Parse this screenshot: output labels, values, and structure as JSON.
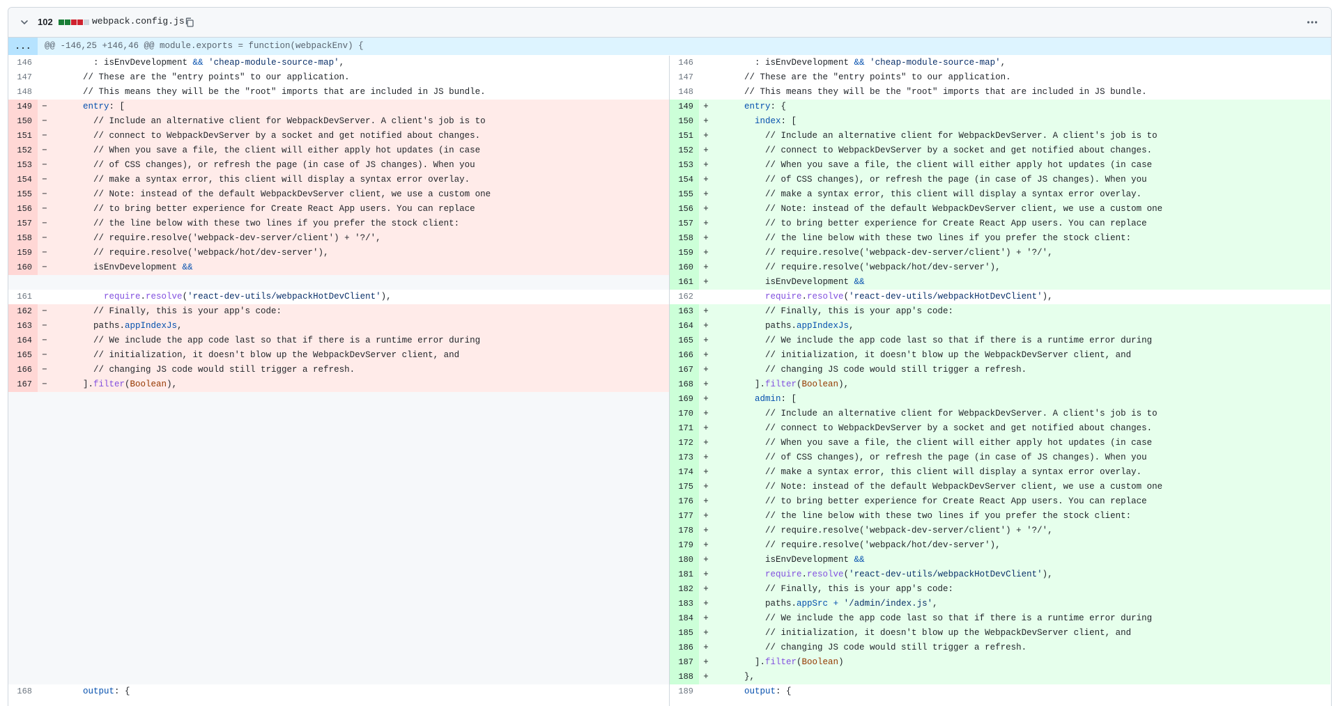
{
  "file": {
    "change_count": "102",
    "name": "webpack.config.js",
    "diffstat_colors": [
      "#1a7f37",
      "#1a7f37",
      "#cf222e",
      "#cf222e",
      "#d0d7de"
    ]
  },
  "hunk": {
    "expander_label": "...",
    "header": "@@ -146,25 +146,46 @@ module.exports = function(webpackEnv) {"
  },
  "left": [
    {
      "type": "ctx",
      "num": "146",
      "marker": "",
      "code": "        : isEnvDevelopment && 'cheap-module-source-map',"
    },
    {
      "type": "ctx",
      "num": "147",
      "marker": "",
      "code": "      // These are the \"entry points\" to our application."
    },
    {
      "type": "ctx",
      "num": "148",
      "marker": "",
      "code": "      // This means they will be the \"root\" imports that are included in JS bundle."
    },
    {
      "type": "del",
      "num": "149",
      "marker": "−",
      "code": "      entry: ["
    },
    {
      "type": "del",
      "num": "150",
      "marker": "−",
      "code": "        // Include an alternative client for WebpackDevServer. A client's job is to"
    },
    {
      "type": "del",
      "num": "151",
      "marker": "−",
      "code": "        // connect to WebpackDevServer by a socket and get notified about changes."
    },
    {
      "type": "del",
      "num": "152",
      "marker": "−",
      "code": "        // When you save a file, the client will either apply hot updates (in case"
    },
    {
      "type": "del",
      "num": "153",
      "marker": "−",
      "code": "        // of CSS changes), or refresh the page (in case of JS changes). When you"
    },
    {
      "type": "del",
      "num": "154",
      "marker": "−",
      "code": "        // make a syntax error, this client will display a syntax error overlay."
    },
    {
      "type": "del",
      "num": "155",
      "marker": "−",
      "code": "        // Note: instead of the default WebpackDevServer client, we use a custom one"
    },
    {
      "type": "del",
      "num": "156",
      "marker": "−",
      "code": "        // to bring better experience for Create React App users. You can replace"
    },
    {
      "type": "del",
      "num": "157",
      "marker": "−",
      "code": "        // the line below with these two lines if you prefer the stock client:"
    },
    {
      "type": "del",
      "num": "158",
      "marker": "−",
      "code": "        // require.resolve('webpack-dev-server/client') + '?/',"
    },
    {
      "type": "del",
      "num": "159",
      "marker": "−",
      "code": "        // require.resolve('webpack/hot/dev-server'),"
    },
    {
      "type": "del",
      "num": "160",
      "marker": "−",
      "code": "        isEnvDevelopment &&"
    },
    {
      "type": "empty",
      "num": "",
      "marker": "",
      "code": ""
    },
    {
      "type": "ctx",
      "num": "161",
      "marker": "",
      "code": "          require.resolve('react-dev-utils/webpackHotDevClient'),"
    },
    {
      "type": "del",
      "num": "162",
      "marker": "−",
      "code": "        // Finally, this is your app's code:"
    },
    {
      "type": "del",
      "num": "163",
      "marker": "−",
      "code": "        paths.appIndexJs,"
    },
    {
      "type": "del",
      "num": "164",
      "marker": "−",
      "code": "        // We include the app code last so that if there is a runtime error during"
    },
    {
      "type": "del",
      "num": "165",
      "marker": "−",
      "code": "        // initialization, it doesn't blow up the WebpackDevServer client, and"
    },
    {
      "type": "del",
      "num": "166",
      "marker": "−",
      "code": "        // changing JS code would still trigger a refresh."
    },
    {
      "type": "del",
      "num": "167",
      "marker": "−",
      "code": "      ].filter(Boolean),"
    },
    {
      "type": "empty",
      "num": "",
      "marker": "",
      "code": ""
    },
    {
      "type": "empty",
      "num": "",
      "marker": "",
      "code": ""
    },
    {
      "type": "empty",
      "num": "",
      "marker": "",
      "code": ""
    },
    {
      "type": "empty",
      "num": "",
      "marker": "",
      "code": ""
    },
    {
      "type": "empty",
      "num": "",
      "marker": "",
      "code": ""
    },
    {
      "type": "empty",
      "num": "",
      "marker": "",
      "code": ""
    },
    {
      "type": "empty",
      "num": "",
      "marker": "",
      "code": ""
    },
    {
      "type": "empty",
      "num": "",
      "marker": "",
      "code": ""
    },
    {
      "type": "empty",
      "num": "",
      "marker": "",
      "code": ""
    },
    {
      "type": "empty",
      "num": "",
      "marker": "",
      "code": ""
    },
    {
      "type": "empty",
      "num": "",
      "marker": "",
      "code": ""
    },
    {
      "type": "empty",
      "num": "",
      "marker": "",
      "code": ""
    },
    {
      "type": "empty",
      "num": "",
      "marker": "",
      "code": ""
    },
    {
      "type": "empty",
      "num": "",
      "marker": "",
      "code": ""
    },
    {
      "type": "empty",
      "num": "",
      "marker": "",
      "code": ""
    },
    {
      "type": "empty",
      "num": "",
      "marker": "",
      "code": ""
    },
    {
      "type": "empty",
      "num": "",
      "marker": "",
      "code": ""
    },
    {
      "type": "empty",
      "num": "",
      "marker": "",
      "code": ""
    },
    {
      "type": "empty",
      "num": "",
      "marker": "",
      "code": ""
    },
    {
      "type": "empty",
      "num": "",
      "marker": "",
      "code": ""
    },
    {
      "type": "ctx",
      "num": "168",
      "marker": "",
      "code": "      output: {"
    }
  ],
  "right": [
    {
      "type": "ctx",
      "num": "146",
      "marker": "",
      "code": "        : isEnvDevelopment && 'cheap-module-source-map',"
    },
    {
      "type": "ctx",
      "num": "147",
      "marker": "",
      "code": "      // These are the \"entry points\" to our application."
    },
    {
      "type": "ctx",
      "num": "148",
      "marker": "",
      "code": "      // This means they will be the \"root\" imports that are included in JS bundle."
    },
    {
      "type": "add",
      "num": "149",
      "marker": "+",
      "code": "      entry: {"
    },
    {
      "type": "add",
      "num": "150",
      "marker": "+",
      "code": "        index: ["
    },
    {
      "type": "add",
      "num": "151",
      "marker": "+",
      "code": "          // Include an alternative client for WebpackDevServer. A client's job is to"
    },
    {
      "type": "add",
      "num": "152",
      "marker": "+",
      "code": "          // connect to WebpackDevServer by a socket and get notified about changes."
    },
    {
      "type": "add",
      "num": "153",
      "marker": "+",
      "code": "          // When you save a file, the client will either apply hot updates (in case"
    },
    {
      "type": "add",
      "num": "154",
      "marker": "+",
      "code": "          // of CSS changes), or refresh the page (in case of JS changes). When you"
    },
    {
      "type": "add",
      "num": "155",
      "marker": "+",
      "code": "          // make a syntax error, this client will display a syntax error overlay."
    },
    {
      "type": "add",
      "num": "156",
      "marker": "+",
      "code": "          // Note: instead of the default WebpackDevServer client, we use a custom one"
    },
    {
      "type": "add",
      "num": "157",
      "marker": "+",
      "code": "          // to bring better experience for Create React App users. You can replace"
    },
    {
      "type": "add",
      "num": "158",
      "marker": "+",
      "code": "          // the line below with these two lines if you prefer the stock client:"
    },
    {
      "type": "add",
      "num": "159",
      "marker": "+",
      "code": "          // require.resolve('webpack-dev-server/client') + '?/',"
    },
    {
      "type": "add",
      "num": "160",
      "marker": "+",
      "code": "          // require.resolve('webpack/hot/dev-server'),"
    },
    {
      "type": "add",
      "num": "161",
      "marker": "+",
      "code": "          isEnvDevelopment &&"
    },
    {
      "type": "ctx",
      "num": "162",
      "marker": "",
      "code": "          require.resolve('react-dev-utils/webpackHotDevClient'),"
    },
    {
      "type": "add",
      "num": "163",
      "marker": "+",
      "code": "          // Finally, this is your app's code:"
    },
    {
      "type": "add",
      "num": "164",
      "marker": "+",
      "code": "          paths.appIndexJs,"
    },
    {
      "type": "add",
      "num": "165",
      "marker": "+",
      "code": "          // We include the app code last so that if there is a runtime error during"
    },
    {
      "type": "add",
      "num": "166",
      "marker": "+",
      "code": "          // initialization, it doesn't blow up the WebpackDevServer client, and"
    },
    {
      "type": "add",
      "num": "167",
      "marker": "+",
      "code": "          // changing JS code would still trigger a refresh."
    },
    {
      "type": "add",
      "num": "168",
      "marker": "+",
      "code": "        ].filter(Boolean),"
    },
    {
      "type": "add",
      "num": "169",
      "marker": "+",
      "code": "        admin: ["
    },
    {
      "type": "add",
      "num": "170",
      "marker": "+",
      "code": "          // Include an alternative client for WebpackDevServer. A client's job is to"
    },
    {
      "type": "add",
      "num": "171",
      "marker": "+",
      "code": "          // connect to WebpackDevServer by a socket and get notified about changes."
    },
    {
      "type": "add",
      "num": "172",
      "marker": "+",
      "code": "          // When you save a file, the client will either apply hot updates (in case"
    },
    {
      "type": "add",
      "num": "173",
      "marker": "+",
      "code": "          // of CSS changes), or refresh the page (in case of JS changes). When you"
    },
    {
      "type": "add",
      "num": "174",
      "marker": "+",
      "code": "          // make a syntax error, this client will display a syntax error overlay."
    },
    {
      "type": "add",
      "num": "175",
      "marker": "+",
      "code": "          // Note: instead of the default WebpackDevServer client, we use a custom one"
    },
    {
      "type": "add",
      "num": "176",
      "marker": "+",
      "code": "          // to bring better experience for Create React App users. You can replace"
    },
    {
      "type": "add",
      "num": "177",
      "marker": "+",
      "code": "          // the line below with these two lines if you prefer the stock client:"
    },
    {
      "type": "add",
      "num": "178",
      "marker": "+",
      "code": "          // require.resolve('webpack-dev-server/client') + '?/',"
    },
    {
      "type": "add",
      "num": "179",
      "marker": "+",
      "code": "          // require.resolve('webpack/hot/dev-server'),"
    },
    {
      "type": "add",
      "num": "180",
      "marker": "+",
      "code": "          isEnvDevelopment &&"
    },
    {
      "type": "add",
      "num": "181",
      "marker": "+",
      "code": "          require.resolve('react-dev-utils/webpackHotDevClient'),"
    },
    {
      "type": "add",
      "num": "182",
      "marker": "+",
      "code": "          // Finally, this is your app's code:"
    },
    {
      "type": "add",
      "num": "183",
      "marker": "+",
      "code": "          paths.appSrc + '/admin/index.js',"
    },
    {
      "type": "add",
      "num": "184",
      "marker": "+",
      "code": "          // We include the app code last so that if there is a runtime error during"
    },
    {
      "type": "add",
      "num": "185",
      "marker": "+",
      "code": "          // initialization, it doesn't blow up the WebpackDevServer client, and"
    },
    {
      "type": "add",
      "num": "186",
      "marker": "+",
      "code": "          // changing JS code would still trigger a refresh."
    },
    {
      "type": "add",
      "num": "187",
      "marker": "+",
      "code": "        ].filter(Boolean)"
    },
    {
      "type": "add",
      "num": "188",
      "marker": "+",
      "code": "      },"
    },
    {
      "type": "ctx",
      "num": "189",
      "marker": "",
      "code": "      output: {"
    }
  ]
}
